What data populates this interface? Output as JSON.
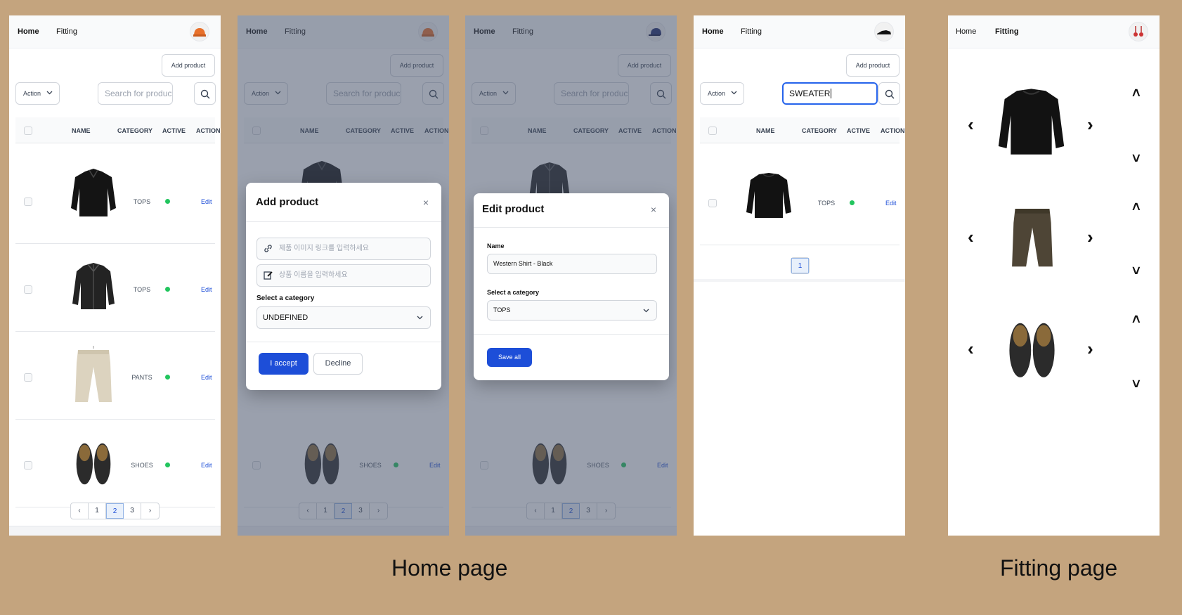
{
  "nav": {
    "home": "Home",
    "fitting": "Fitting"
  },
  "toolbar": {
    "add_product": "Add product",
    "action": "Action",
    "search_placeholder": "Search for products",
    "search_value": "SWEATER"
  },
  "table": {
    "headers": {
      "name": "NAME",
      "category": "CATEGORY",
      "active": "ACTIVE",
      "action": "ACTION"
    },
    "rows": [
      {
        "category": "TOPS",
        "edit": "Edit",
        "active": true
      },
      {
        "category": "TOPS",
        "edit": "Edit",
        "active": true
      },
      {
        "category": "PANTS",
        "edit": "Edit",
        "active": true
      },
      {
        "category": "SHOES",
        "edit": "Edit",
        "active": true
      }
    ],
    "search_rows": [
      {
        "category": "TOPS",
        "edit": "Edit",
        "active": true
      }
    ]
  },
  "pagination": {
    "pages": [
      "1",
      "2",
      "3"
    ],
    "current": "2",
    "search_pages": [
      "1"
    ]
  },
  "add_modal": {
    "title": "Add product",
    "close": "×",
    "image_placeholder": "제품 이미지 링크를 입력하세요",
    "name_placeholder": "상품 이름을 입력하세요",
    "category_label": "Select a category",
    "category_value": "UNDEFINED",
    "accept": "I accept",
    "decline": "Decline"
  },
  "edit_modal": {
    "title": "Edit product",
    "close": "×",
    "name_label": "Name",
    "name_value": "Western Shirt - Black",
    "category_label": "Select a category",
    "category_value": "TOPS",
    "save": "Save all"
  },
  "fitting": {
    "prev": "‹",
    "next": "›",
    "up": "˄",
    "down": "˅"
  },
  "captions": {
    "home": "Home page",
    "fitting": "Fitting page"
  },
  "colors": {
    "background": "#c4a47e",
    "primary": "#1d4ed8",
    "active_dot": "#22c55e",
    "overlay": "#475269"
  },
  "icons": [
    "beanie-icon",
    "cap-icon",
    "shoe-icon",
    "earring-icon",
    "search-icon",
    "link-icon",
    "edit-icon",
    "chevron-down-icon",
    "chevron-left-icon",
    "chevron-right-icon",
    "chevron-up-icon",
    "close-icon"
  ]
}
